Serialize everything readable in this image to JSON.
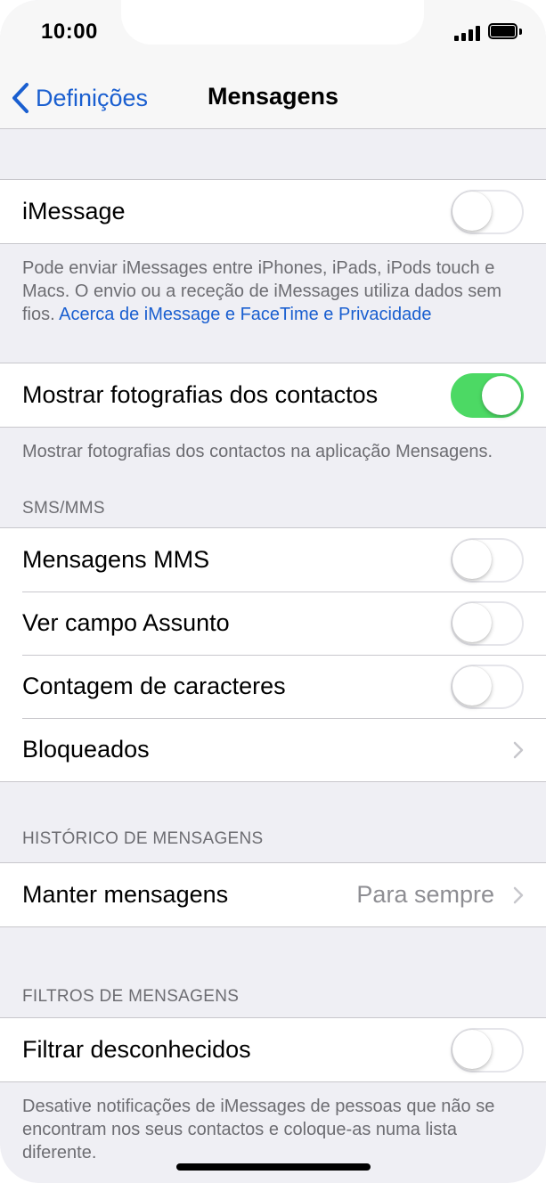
{
  "status_bar": {
    "time": "10:00"
  },
  "nav": {
    "back_label": "Definições",
    "title": "Mensagens"
  },
  "imessage": {
    "label": "iMessage",
    "enabled": false,
    "footer": "Pode enviar iMessages entre iPhones, iPads, iPods touch e Macs. O envio ou a receção de iMessages utiliza dados sem fios.",
    "footer_link": "Acerca de iMessage e FaceTime e Privacidade"
  },
  "contact_photos": {
    "label": "Mostrar fotografias dos contactos",
    "enabled": true,
    "footer": "Mostrar fotografias dos contactos na aplicação Mensagens."
  },
  "sms_mms": {
    "header": "SMS/MMS",
    "items": [
      {
        "label": "Mensagens MMS",
        "enabled": false
      },
      {
        "label": "Ver campo Assunto",
        "enabled": false
      },
      {
        "label": "Contagem de caracteres",
        "enabled": false
      }
    ],
    "blocked_label": "Bloqueados"
  },
  "history": {
    "header": "HISTÓRICO DE MENSAGENS",
    "keep_label": "Manter mensagens",
    "keep_value": "Para sempre"
  },
  "filters": {
    "header": "FILTROS DE MENSAGENS",
    "filter_label": "Filtrar desconhecidos",
    "enabled": false,
    "footer": "Desative notificações de iMessages de pessoas que não se encontram nos seus contactos e coloque-as numa lista diferente."
  },
  "colors": {
    "accent": "#1a5fd0",
    "toggle_on": "#4cd964",
    "background": "#efeff4"
  },
  "icons": [
    "back-chevron-icon",
    "chevron-right-icon",
    "signal-icon",
    "battery-icon"
  ]
}
